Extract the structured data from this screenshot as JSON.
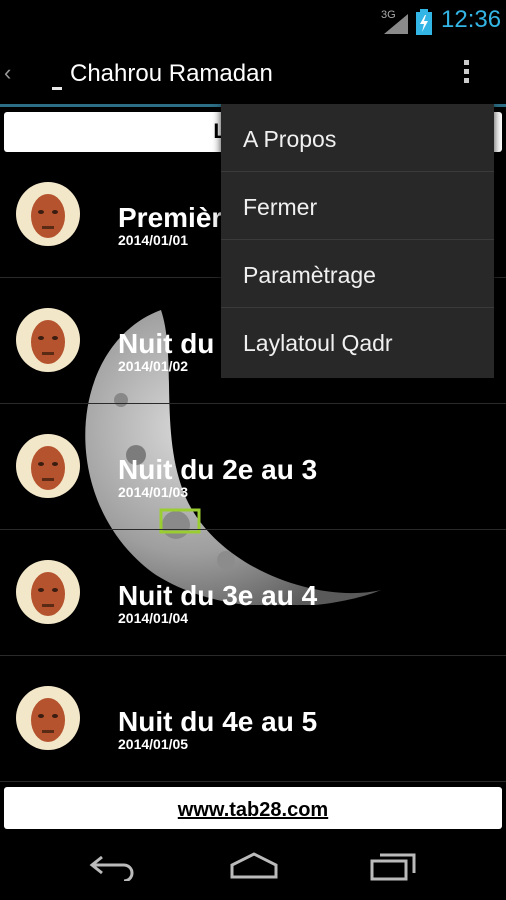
{
  "status_bar": {
    "network_label": "3G",
    "time": "12:36"
  },
  "action_bar": {
    "title": "Chahrou Ramadan",
    "up_caret": "‹"
  },
  "header": {
    "label": "Le mois"
  },
  "items": [
    {
      "title": "Premièr",
      "date": "2014/01/01"
    },
    {
      "title": "Nuit du",
      "date": "2014/01/02"
    },
    {
      "title": "Nuit du 2e au 3",
      "date": "2014/01/03"
    },
    {
      "title": "Nuit du 3e au 4",
      "date": "2014/01/04"
    },
    {
      "title": "Nuit du 4e au 5",
      "date": "2014/01/05"
    }
  ],
  "overflow_menu": [
    {
      "label": "A Propos"
    },
    {
      "label": "Fermer"
    },
    {
      "label": "Paramètrage"
    },
    {
      "label": "Laylatoul Qadr"
    }
  ],
  "footer": {
    "link": "www.tab28.com"
  },
  "colors": {
    "accent": "#33b5e5",
    "actionbar_divider": "#2c6e86",
    "menu_bg": "#282828",
    "avatar_bg": "#f3e7c9"
  },
  "icons": {
    "app": "crescent-moon-icon",
    "overflow": "overflow-menu-icon",
    "nav": [
      "back-icon",
      "home-icon",
      "recent-apps-icon"
    ]
  }
}
